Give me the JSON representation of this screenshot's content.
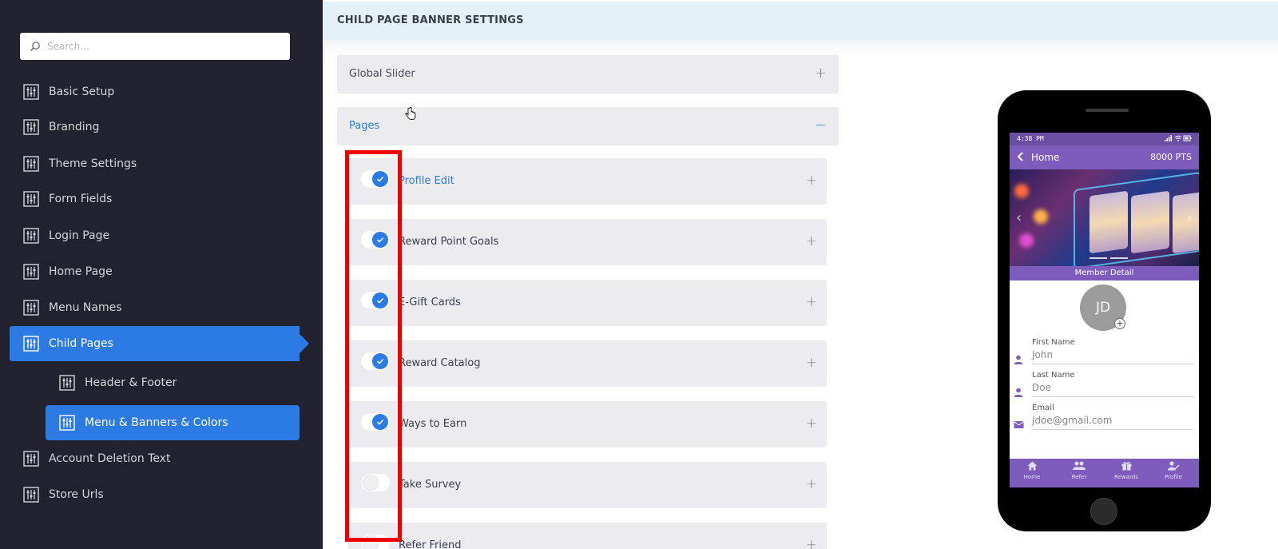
{
  "sidebar": {
    "search_placeholder": "Search...",
    "items": [
      {
        "label": "Basic Setup"
      },
      {
        "label": "Branding"
      },
      {
        "label": "Theme Settings"
      },
      {
        "label": "Form Fields"
      },
      {
        "label": "Login Page"
      },
      {
        "label": "Home Page"
      },
      {
        "label": "Menu Names"
      },
      {
        "label": "Child Pages",
        "active": true
      },
      {
        "label": "Header & Footer",
        "sub": true
      },
      {
        "label": "Menu & Banners & Colors",
        "sub": true,
        "active": true
      },
      {
        "label": "Account Deletion Text"
      },
      {
        "label": "Store Urls"
      }
    ]
  },
  "header": {
    "title": "CHILD PAGE BANNER SETTINGS"
  },
  "accordions": {
    "global_slider": {
      "label": "Global Slider",
      "sign": "+"
    },
    "pages": {
      "label": "Pages",
      "sign": "−"
    }
  },
  "pages": [
    {
      "label": "Profile Edit",
      "enabled": true,
      "sign": "+"
    },
    {
      "label": "Reward Point Goals",
      "enabled": true,
      "sign": "+"
    },
    {
      "label": "E-Gift Cards",
      "enabled": true,
      "sign": "+"
    },
    {
      "label": "Reward Catalog",
      "enabled": true,
      "sign": "+"
    },
    {
      "label": "Ways to Earn",
      "enabled": true,
      "sign": "+"
    },
    {
      "label": "Take Survey",
      "enabled": false,
      "sign": "+"
    },
    {
      "label": "Refer Friend",
      "enabled": false,
      "sign": "+"
    }
  ],
  "phone": {
    "status_time": "4:38 PM",
    "appbar_title": "Home",
    "points": "8000 PTS",
    "member_bar": "Member Detail",
    "avatar_initials": "JD",
    "fields": [
      {
        "label": "First Name",
        "value": "John",
        "icon": "person-icon"
      },
      {
        "label": "Last Name",
        "value": "Doe",
        "icon": "person-icon"
      },
      {
        "label": "Email",
        "value": "jdoe@gmail.com",
        "icon": "mail-icon"
      }
    ],
    "tabs": [
      {
        "label": "Home",
        "icon": "home-icon"
      },
      {
        "label": "Refer",
        "icon": "people-icon"
      },
      {
        "label": "Rewards",
        "icon": "gift-icon"
      },
      {
        "label": "Profile",
        "icon": "profile-edit-icon"
      }
    ]
  },
  "colors": {
    "sidebar_bg": "#212130",
    "accent": "#2c7be5",
    "highlight_box": "#e00000",
    "phone_purple": "#7e5cbd"
  }
}
